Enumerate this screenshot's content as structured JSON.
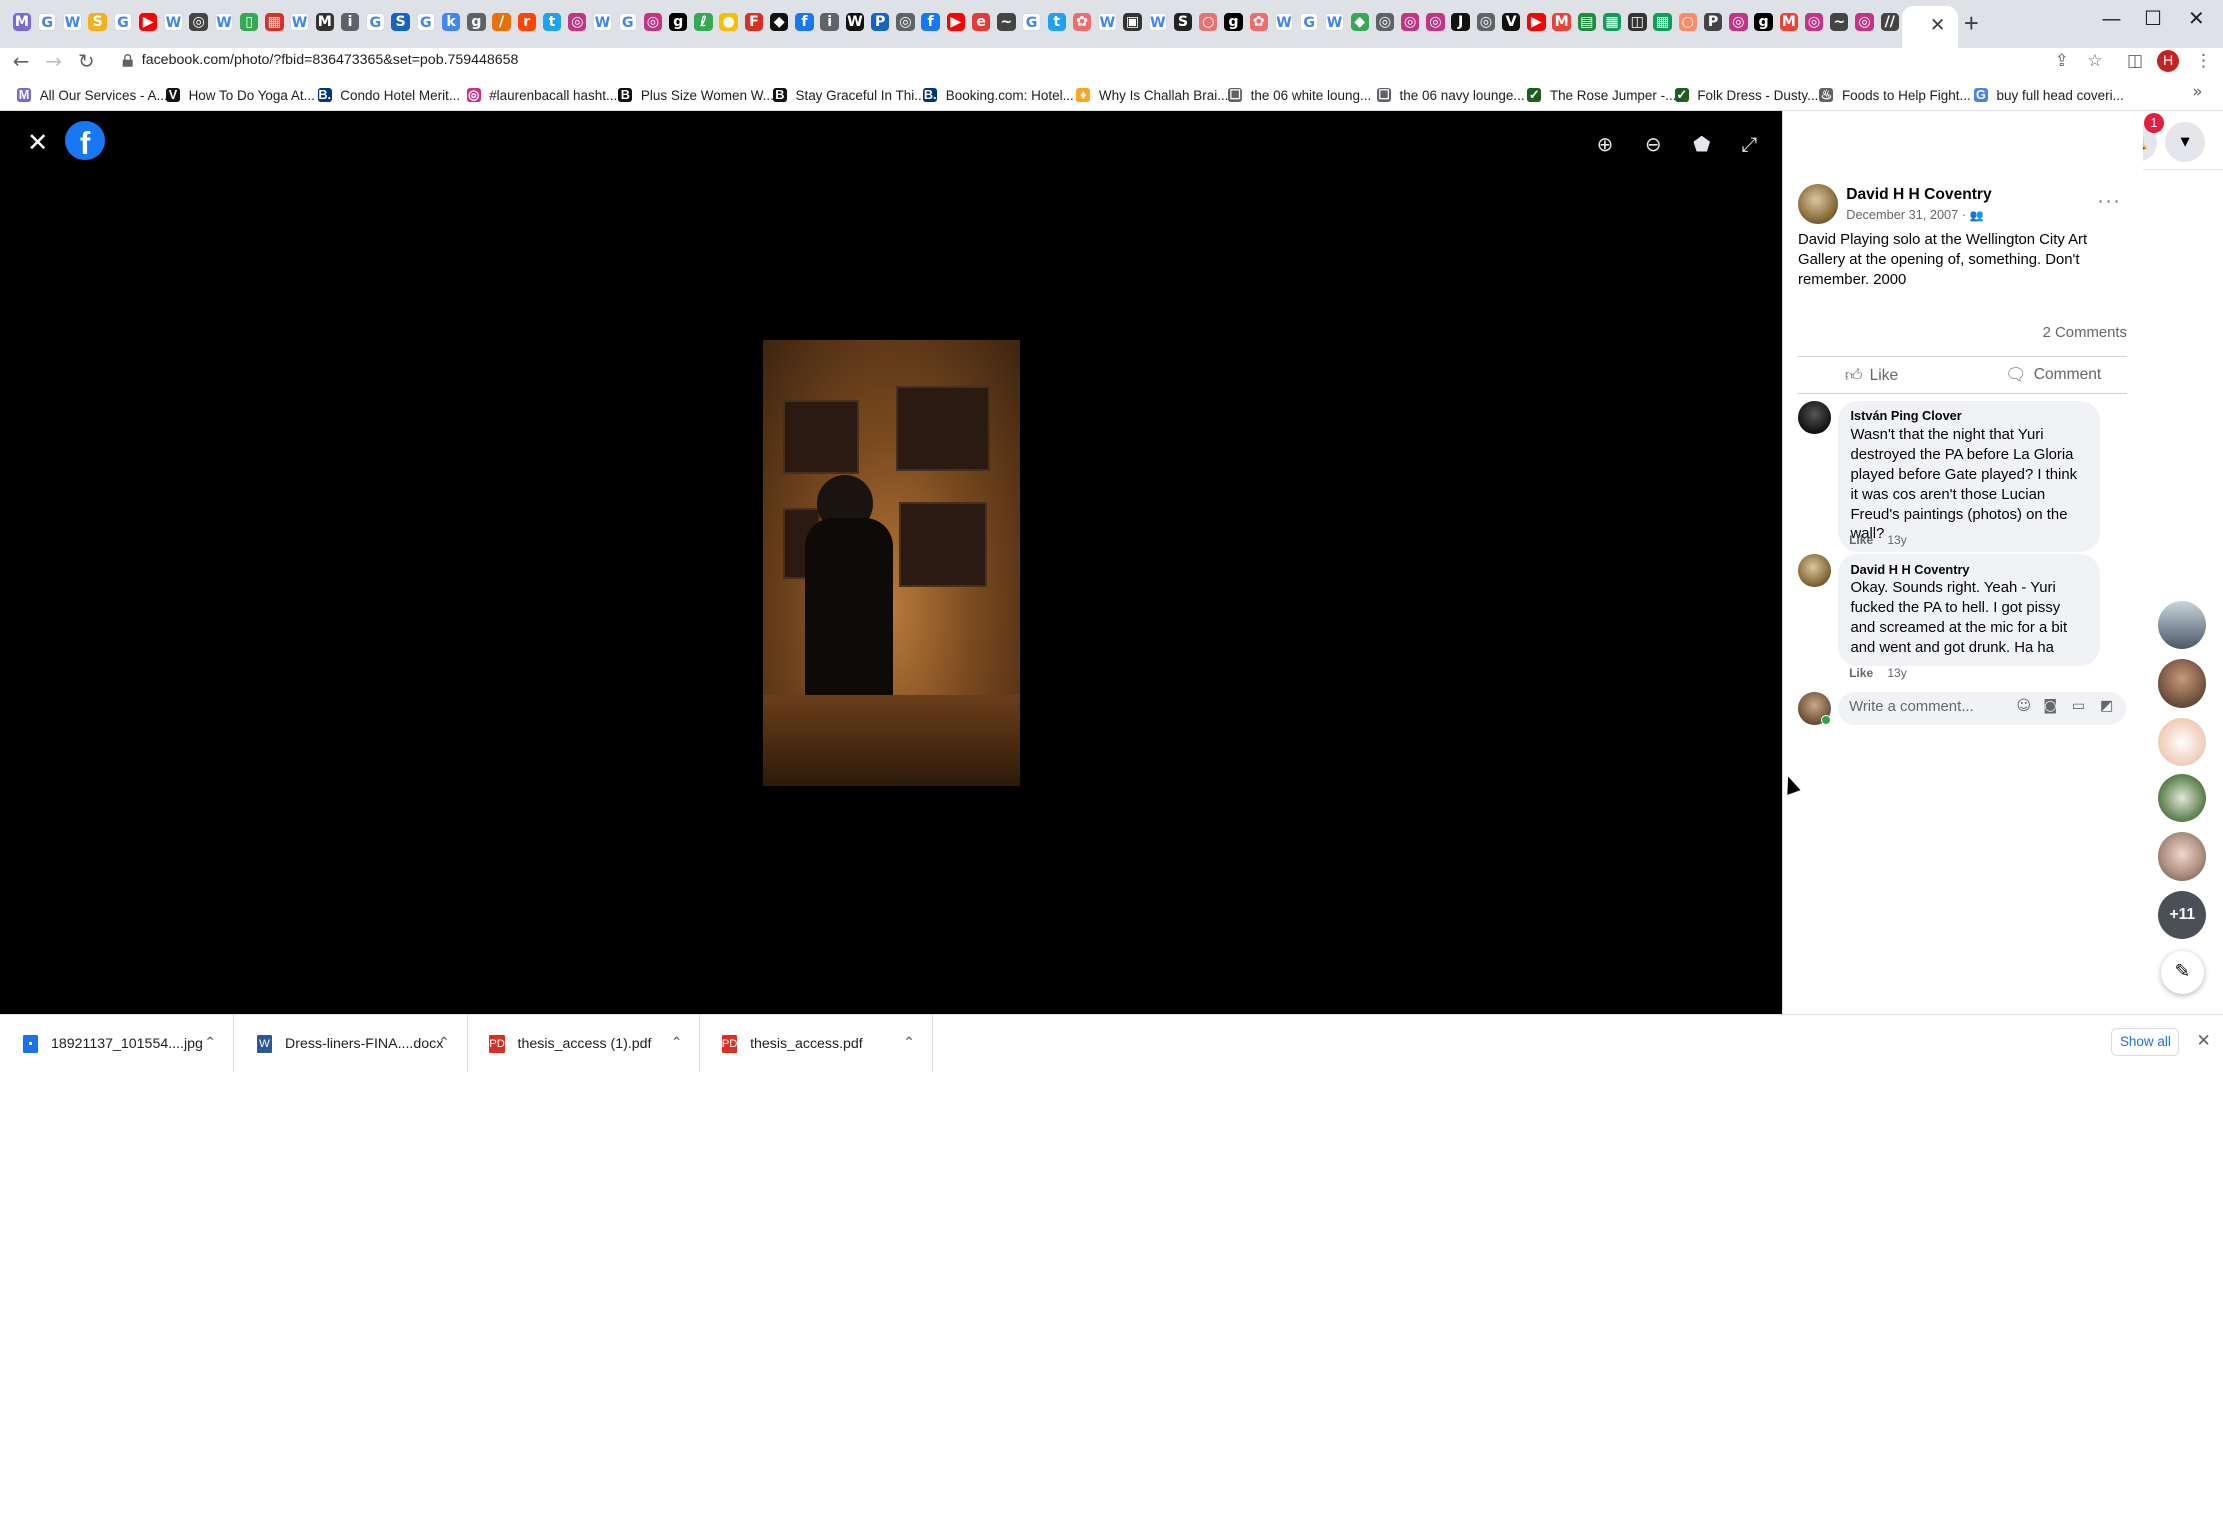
{
  "browser": {
    "url": "facebook.com/photo/?fbid=836473365&set=pob.759448658",
    "tab_close": "✕",
    "new_tab": "+",
    "profile_initial": "H",
    "tab_favicons": [
      {
        "glyph": "M",
        "color": "#7a6ad8"
      },
      {
        "glyph": "G",
        "color": "#ffffff"
      },
      {
        "glyph": "W",
        "color": "#ffffff"
      },
      {
        "glyph": "S",
        "color": "#f2b01e"
      },
      {
        "glyph": "G",
        "color": "#ffffff"
      },
      {
        "glyph": "▶",
        "color": "#ff0000"
      },
      {
        "glyph": "W",
        "color": "#ffffff"
      },
      {
        "glyph": "◎",
        "color": "#444444"
      },
      {
        "glyph": "W",
        "color": "#ffffff"
      },
      {
        "glyph": "▯",
        "color": "#34a853"
      },
      {
        "glyph": "▦",
        "color": "#d93025"
      },
      {
        "glyph": "W",
        "color": "#ffffff"
      },
      {
        "glyph": "M",
        "color": "#333333"
      },
      {
        "glyph": "i",
        "color": "#5f6368"
      },
      {
        "glyph": "G",
        "color": "#ffffff"
      },
      {
        "glyph": "S",
        "color": "#1565c0"
      },
      {
        "glyph": "G",
        "color": "#ffffff"
      },
      {
        "glyph": "k",
        "color": "#4285f4"
      },
      {
        "glyph": "g",
        "color": "#5f6368"
      },
      {
        "glyph": "/",
        "color": "#e8710a"
      },
      {
        "glyph": "r",
        "color": "#ff4500"
      },
      {
        "glyph": "t",
        "color": "#1da1f2"
      },
      {
        "glyph": "◎",
        "color": "#c13584"
      },
      {
        "glyph": "W",
        "color": "#ffffff"
      },
      {
        "glyph": "G",
        "color": "#ffffff"
      },
      {
        "glyph": "◎",
        "color": "#c13584"
      },
      {
        "glyph": "g",
        "color": "#000000"
      },
      {
        "glyph": "ℓ",
        "color": "#34a853"
      },
      {
        "glyph": "●",
        "color": "#fbbc04"
      },
      {
        "glyph": "F",
        "color": "#d93025"
      },
      {
        "glyph": "◆",
        "color": "#111111"
      },
      {
        "glyph": "f",
        "color": "#1877f2"
      },
      {
        "glyph": "i",
        "color": "#5f6368"
      },
      {
        "glyph": "W",
        "color": "#111111"
      },
      {
        "glyph": "P",
        "color": "#1565c0"
      },
      {
        "glyph": "◎",
        "color": "#5f6368"
      },
      {
        "glyph": "f",
        "color": "#1877f2"
      },
      {
        "glyph": "▶",
        "color": "#ff0000"
      },
      {
        "glyph": "e",
        "color": "#e53935"
      },
      {
        "glyph": "~",
        "color": "#444444"
      },
      {
        "glyph": "G",
        "color": "#ffffff"
      },
      {
        "glyph": "t",
        "color": "#1da1f2"
      },
      {
        "glyph": "✿",
        "color": "#ef6c6c"
      },
      {
        "glyph": "W",
        "color": "#ffffff"
      },
      {
        "glyph": "▣",
        "color": "#333333"
      },
      {
        "glyph": "W",
        "color": "#ffffff"
      },
      {
        "glyph": "S",
        "color": "#222222"
      },
      {
        "glyph": "○",
        "color": "#e57373"
      },
      {
        "glyph": "g",
        "color": "#000000"
      },
      {
        "glyph": "✿",
        "color": "#ef6c6c"
      },
      {
        "glyph": "W",
        "color": "#ffffff"
      },
      {
        "glyph": "G",
        "color": "#ffffff"
      },
      {
        "glyph": "W",
        "color": "#ffffff"
      },
      {
        "glyph": "◆",
        "color": "#34a853"
      },
      {
        "glyph": "◎",
        "color": "#5f6368"
      },
      {
        "glyph": "◎",
        "color": "#c13584"
      },
      {
        "glyph": "◎",
        "color": "#c13584"
      },
      {
        "glyph": "J",
        "color": "#111111"
      },
      {
        "glyph": "◎",
        "color": "#5f6368"
      },
      {
        "glyph": "V",
        "color": "#111111"
      },
      {
        "glyph": "▶",
        "color": "#ff0000"
      },
      {
        "glyph": "M",
        "color": "#ea4335"
      },
      {
        "glyph": "▤",
        "color": "#1e8e3e"
      },
      {
        "glyph": "▦",
        "color": "#0f9d58"
      },
      {
        "glyph": "◫",
        "color": "#333333"
      },
      {
        "glyph": "▦",
        "color": "#0f9d58"
      },
      {
        "glyph": "○",
        "color": "#ff8a65"
      },
      {
        "glyph": "P",
        "color": "#444444"
      },
      {
        "glyph": "◎",
        "color": "#c13584"
      },
      {
        "glyph": "g",
        "color": "#000000"
      },
      {
        "glyph": "M",
        "color": "#ea4335"
      },
      {
        "glyph": "◎",
        "color": "#c13584"
      },
      {
        "glyph": "~",
        "color": "#444444"
      },
      {
        "glyph": "◎",
        "color": "#c13584"
      },
      {
        "glyph": "//",
        "color": "#444444"
      }
    ]
  },
  "bookmarks": [
    {
      "label": "All Our Services - A...",
      "icon": "M",
      "color": "#7a6ad8"
    },
    {
      "label": "How To Do Yoga At...",
      "icon": "V",
      "color": "#111111"
    },
    {
      "label": "Condo Hotel Merit...",
      "icon": "B.",
      "color": "#003580"
    },
    {
      "label": "#laurenbacall hasht...",
      "icon": "◎",
      "color": "#c13584"
    },
    {
      "label": "Plus Size Women W...",
      "icon": "B",
      "color": "#111111"
    },
    {
      "label": "Stay Graceful In Thi...",
      "icon": "B",
      "color": "#111111"
    },
    {
      "label": "Booking.com: Hotel...",
      "icon": "B.",
      "color": "#003580"
    },
    {
      "label": "Why Is Challah Brai...",
      "icon": "♦",
      "color": "#f9a825"
    },
    {
      "label": "the 06 white loung...",
      "icon": "☐",
      "color": "#5f6368"
    },
    {
      "label": "the 06 navy lounge...",
      "icon": "☐",
      "color": "#5f6368"
    },
    {
      "label": "The Rose Jumper -...",
      "icon": "✓",
      "color": "#1b5e20"
    },
    {
      "label": "Folk Dress - Dusty...",
      "icon": "✓",
      "color": "#1b5e20"
    },
    {
      "label": "Foods to Help Fight...",
      "icon": "♨",
      "color": "#5f6368"
    },
    {
      "label": "buy full head coveri...",
      "icon": "G",
      "color": "#4285f4"
    }
  ],
  "viewer": {
    "close_icon": "✕",
    "logo": "f",
    "tools": [
      "⊕",
      "⊖",
      "⬟",
      "⤢"
    ]
  },
  "post": {
    "author": "David H H Coventry",
    "date": "December 31, 2007 · ",
    "privacy_icon": "👥",
    "more": "···",
    "text": "David Playing solo at the Wellington City Art Gallery at the opening of, something. Don't remember. 2000",
    "comment_count": "2 Comments",
    "like_label": "Like",
    "comment_label": "Comment"
  },
  "comments": [
    {
      "author": "István Ping Clover",
      "text": "Wasn't that the night that Yuri destroyed the PA before La Gloria played before Gate played? I think it was cos aren't those Lucian Freud's paintings (photos) on the wall?",
      "like": "Like",
      "time": "13y"
    },
    {
      "author": "David H H Coventry",
      "text": "Okay. Sounds right. Yeah - Yuri fucked the PA to hell. I got pissy and screamed at the mic for a bit and went and got drunk. Ha ha",
      "like": "Like",
      "time": "13y"
    }
  ],
  "composer": {
    "placeholder": "Write a comment..."
  },
  "topnav": {
    "notif_count": "1"
  },
  "contacts_rail": {
    "more_count": "+11"
  },
  "downloads": [
    {
      "name": "18921137_101554....jpg",
      "type": "image",
      "color": "#1a73e8"
    },
    {
      "name": "Dress-liners-FINA....docx",
      "type": "word",
      "color": "#2b579a"
    },
    {
      "name": "thesis_access (1).pdf",
      "type": "pdf",
      "color": "#d93025"
    },
    {
      "name": "thesis_access.pdf",
      "type": "pdf",
      "color": "#d93025"
    }
  ],
  "show_all": "Show all"
}
